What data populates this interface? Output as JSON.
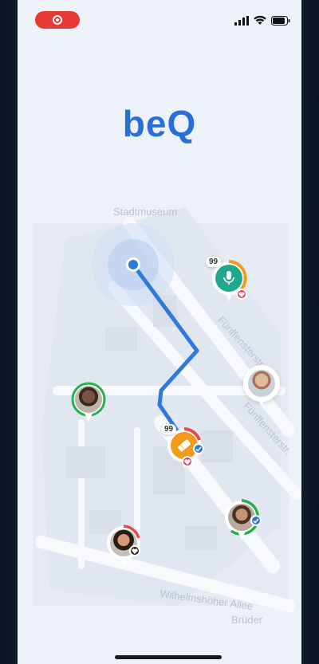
{
  "app": {
    "logo_text": "beQ"
  },
  "map": {
    "street_labels": [
      "Stadtmuseum",
      "Fünffensterstr.",
      "Fünffensterstr.",
      "Wilhelmshöher Allee",
      "Brüder"
    ]
  },
  "pins": {
    "mic_count": "99",
    "ticket_count": "99"
  },
  "colors": {
    "brand_blue": "#2a6fd8",
    "route_blue": "#2f78de",
    "teal": "#20a88f",
    "orange": "#f39a1b",
    "ring_green": "#22b14c",
    "ring_red": "#e84a4a",
    "like_pink": "#e53958",
    "recording_red": "#e53935"
  },
  "icons": [
    "recording-icon",
    "signal-icon",
    "wifi-icon",
    "battery-icon",
    "microphone-icon",
    "ticket-icon",
    "heart-icon",
    "verified-check-icon",
    "user-location-icon"
  ]
}
